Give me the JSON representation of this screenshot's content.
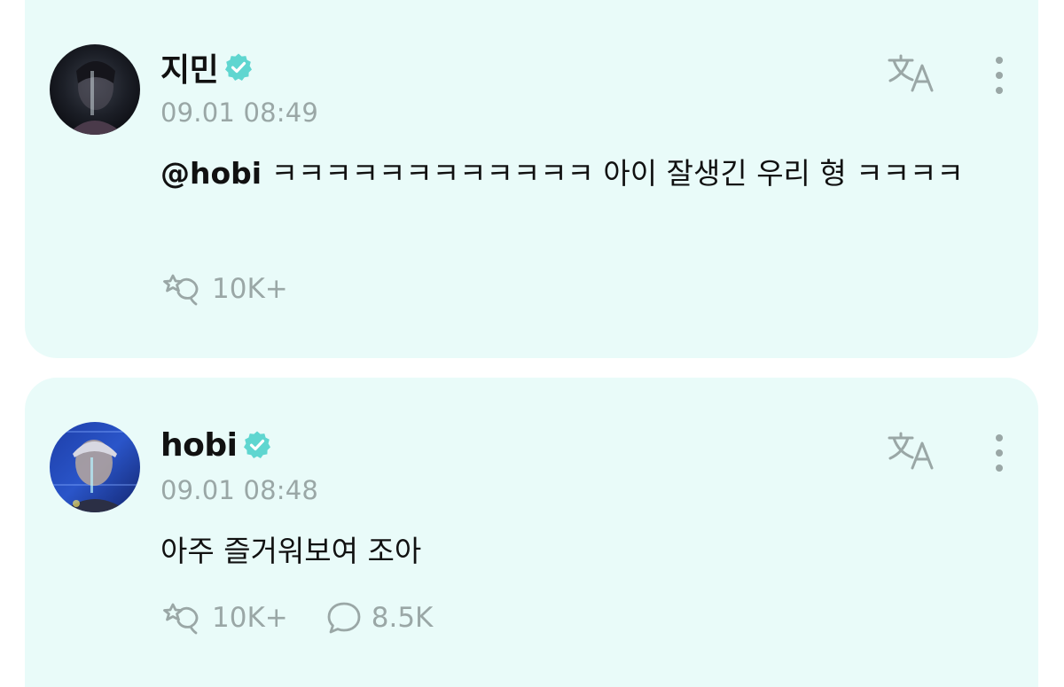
{
  "colors": {
    "card_bg": "#e9fbf9",
    "verified_badge": "#5fd6d0",
    "muted": "#9aa7a6",
    "text": "#111111"
  },
  "posts": [
    {
      "author": "지민",
      "verified_icon": "verified-badge-icon",
      "timestamp": "09.01 08:49",
      "mention": "@hobi",
      "text": " ㅋㅋㅋㅋㅋㅋㅋㅋㅋㅋㅋㅋ 아이 잘생긴 우리 형 ㅋㅋㅋㅋ",
      "likes": "10K+",
      "comments": null
    },
    {
      "author": "hobi",
      "verified_icon": "verified-badge-icon",
      "timestamp": "09.01 08:48",
      "text": "아주 즐거워보여 조아",
      "likes": "10K+",
      "comments": "8.5K"
    }
  ]
}
